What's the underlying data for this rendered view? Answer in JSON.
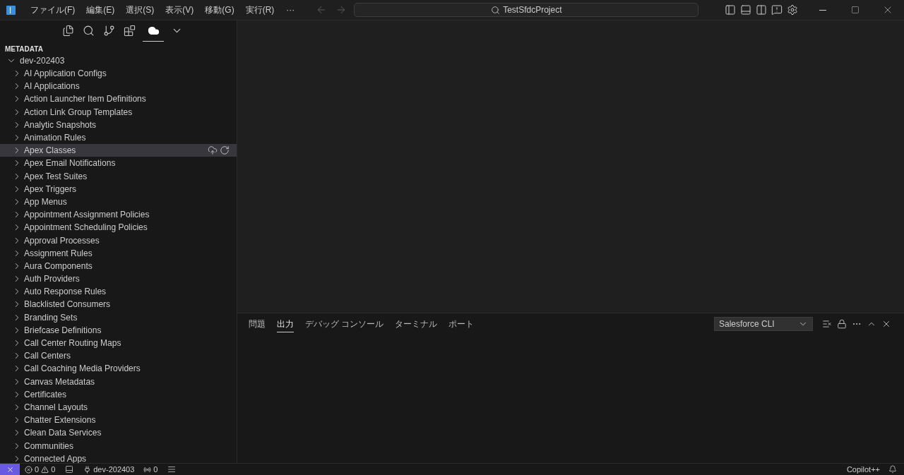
{
  "title_bar": {
    "menu": [
      "ファイル(F)",
      "編集(E)",
      "選択(S)",
      "表示(V)",
      "移動(G)",
      "実行(R)"
    ],
    "more": "···",
    "search": "TestSfdcProject"
  },
  "activity_tabs": [
    {
      "kind": "files",
      "selected": false
    },
    {
      "kind": "search",
      "selected": false
    },
    {
      "kind": "branch",
      "selected": false
    },
    {
      "kind": "extensions",
      "selected": false
    },
    {
      "kind": "cloud",
      "selected": true
    },
    {
      "kind": "more",
      "selected": false
    }
  ],
  "sidebar": {
    "title": "METADATA",
    "root": {
      "label": "dev-202403",
      "expanded": true,
      "children": [
        {
          "label": "AI Application Configs",
          "selected": false
        },
        {
          "label": "AI Applications",
          "selected": false
        },
        {
          "label": "Action Launcher Item Definitions",
          "selected": false
        },
        {
          "label": "Action Link Group Templates",
          "selected": false
        },
        {
          "label": "Analytic Snapshots",
          "selected": false
        },
        {
          "label": "Animation Rules",
          "selected": false
        },
        {
          "label": "Apex Classes",
          "selected": true
        },
        {
          "label": "Apex Email Notifications",
          "selected": false
        },
        {
          "label": "Apex Test Suites",
          "selected": false
        },
        {
          "label": "Apex Triggers",
          "selected": false
        },
        {
          "label": "App Menus",
          "selected": false
        },
        {
          "label": "Appointment Assignment Policies",
          "selected": false
        },
        {
          "label": "Appointment Scheduling Policies",
          "selected": false
        },
        {
          "label": "Approval Processes",
          "selected": false
        },
        {
          "label": "Assignment Rules",
          "selected": false
        },
        {
          "label": "Aura Components",
          "selected": false
        },
        {
          "label": "Auth Providers",
          "selected": false
        },
        {
          "label": "Auto Response Rules",
          "selected": false
        },
        {
          "label": "Blacklisted Consumers",
          "selected": false
        },
        {
          "label": "Branding Sets",
          "selected": false
        },
        {
          "label": "Briefcase Definitions",
          "selected": false
        },
        {
          "label": "Call Center Routing Maps",
          "selected": false
        },
        {
          "label": "Call Centers",
          "selected": false
        },
        {
          "label": "Call Coaching Media Providers",
          "selected": false
        },
        {
          "label": "Canvas Metadatas",
          "selected": false
        },
        {
          "label": "Certificates",
          "selected": false
        },
        {
          "label": "Channel Layouts",
          "selected": false
        },
        {
          "label": "Chatter Extensions",
          "selected": false
        },
        {
          "label": "Clean Data Services",
          "selected": false
        },
        {
          "label": "Communities",
          "selected": false
        },
        {
          "label": "Connected Apps",
          "selected": false
        }
      ]
    }
  },
  "panel": {
    "tabs": [
      {
        "label": "問題",
        "selected": false
      },
      {
        "label": "出力",
        "selected": true
      },
      {
        "label": "デバッグ コンソール",
        "selected": false
      },
      {
        "label": "ターミナル",
        "selected": false
      },
      {
        "label": "ポート",
        "selected": false
      }
    ],
    "output_channel": "Salesforce CLI"
  },
  "status_bar": {
    "errors": "0",
    "warnings": "0",
    "org": "dev-202403",
    "ports": "0",
    "copilot": "Copilot++"
  }
}
